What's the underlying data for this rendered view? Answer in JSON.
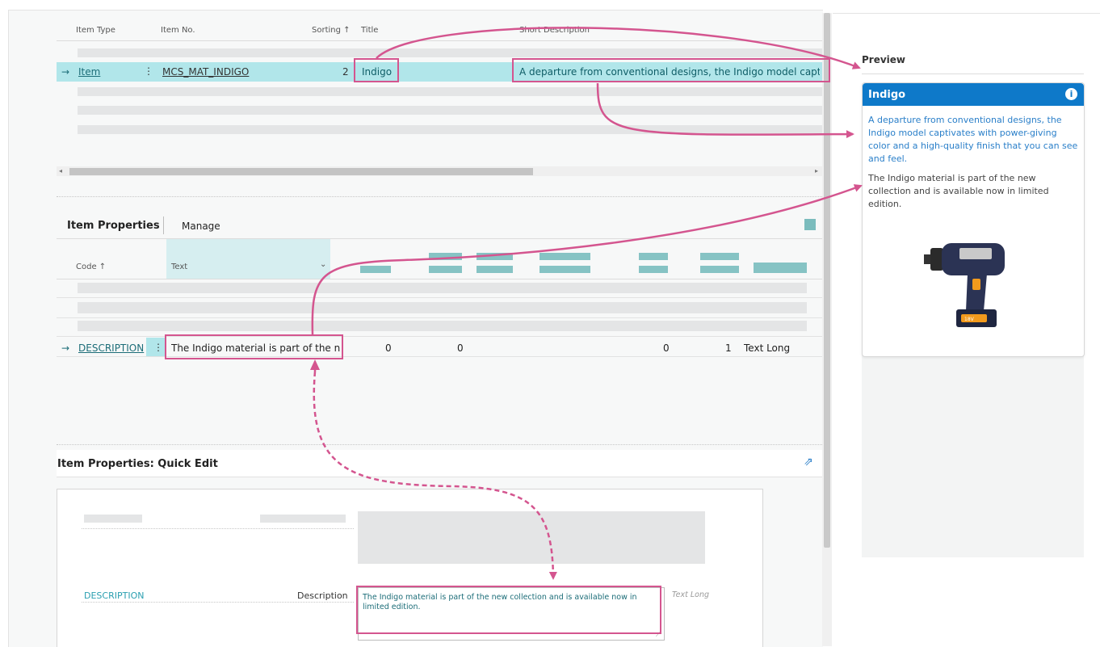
{
  "lines": {
    "columns": {
      "item_type": "Item Type",
      "item_no": "Item No.",
      "sorting": "Sorting ↑",
      "title": "Title",
      "short_description": "Short Description"
    },
    "selected_row": {
      "arrow": "→",
      "item_type": "Item",
      "item_no": "MCS_MAT_INDIGO",
      "sorting": "2",
      "title": "Indigo",
      "short_description": "A departure from conventional designs, the Indigo model captivates w"
    }
  },
  "item_properties": {
    "title": "Item Properties",
    "manage": "Manage",
    "columns": {
      "code": "Code ↑",
      "text": "Text"
    },
    "row": {
      "arrow": "→",
      "code": "DESCRIPTION",
      "text": "The Indigo material is part of the n...",
      "v1": "0",
      "v2": "0",
      "v3": "0",
      "v4": "1",
      "type": "Text Long"
    }
  },
  "quick_edit": {
    "title": "Item Properties: Quick Edit",
    "code": "DESCRIPTION",
    "label": "Description",
    "value": "The Indigo material is part of the new collection and is available now in limited edition.",
    "type_hint": "Text Long"
  },
  "preview": {
    "label": "Preview",
    "card_title": "Indigo",
    "short_description": "A departure from conventional designs, the Indigo model captivates with power-giving color and a high-quality finish that you can see and feel.",
    "long_description": "The Indigo material is part of the new collection and is available now in limited edition.",
    "image_icon": "drill-image"
  },
  "colors": {
    "accent_teal": "#b1e6ea",
    "highlight_pink": "#d4558f",
    "preview_blue": "#0e79c9",
    "link_blue": "#2a7fc9"
  }
}
